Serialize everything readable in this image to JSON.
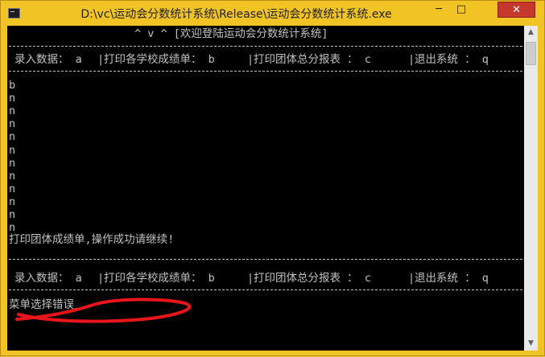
{
  "window": {
    "title": "D:\\vc\\运动会分数统计系统\\Release\\运动会分数统计系统.exe",
    "controls": {
      "minimize": "─",
      "maximize": "□",
      "close": "✕"
    },
    "scroll_icons": {
      "up": "▲",
      "down": "▼"
    }
  },
  "console": {
    "header": "^ v ^ [欢迎登陆运动会分数统计系统]",
    "menu": {
      "item1": "录入数据： a",
      "sep": "|",
      "item2": "打印各学校成绩单： b",
      "item3": "打印团体总分报表 ： c",
      "item4": "退出系统 ： q"
    },
    "input_lines": [
      "b",
      "n",
      "n",
      "n",
      "n",
      "n",
      "n",
      "n",
      "n",
      "n",
      "n",
      "n"
    ],
    "success_message": "打印团体成绩单,操作成功请继续!",
    "error_message": "菜单选择错误"
  },
  "annotation": {
    "color": "#e8161b"
  }
}
